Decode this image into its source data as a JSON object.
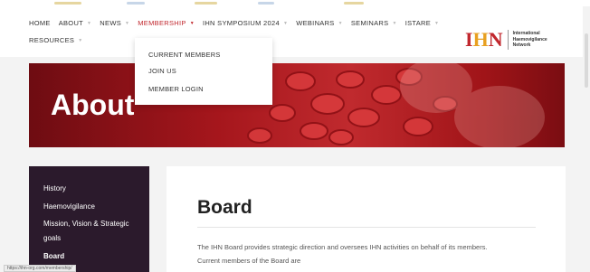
{
  "nav": {
    "row1": [
      {
        "label": "HOME",
        "caret": false,
        "active": false
      },
      {
        "label": "ABOUT",
        "caret": true,
        "active": false
      },
      {
        "label": "NEWS",
        "caret": true,
        "active": false
      },
      {
        "label": "MEMBERSHIP",
        "caret": true,
        "active": true
      },
      {
        "label": "IHN SYMPOSIUM 2024",
        "caret": true,
        "active": false
      },
      {
        "label": "WEBINARS",
        "caret": true,
        "active": false
      },
      {
        "label": "SEMINARS",
        "caret": true,
        "active": false
      },
      {
        "label": "ISTARE",
        "caret": true,
        "active": false
      }
    ],
    "row2": [
      {
        "label": "RESOURCES",
        "caret": true,
        "active": false
      }
    ]
  },
  "logo": {
    "mark_i": "I",
    "mark_h": "H",
    "mark_n": "N",
    "line1": "International",
    "line2": "Haemovigilance",
    "line3": "Network"
  },
  "dropdown": {
    "items": [
      "CURRENT MEMBERS",
      "JOIN US",
      "MEMBER LOGIN"
    ]
  },
  "hero": {
    "title": "About"
  },
  "sidebar": {
    "items": [
      {
        "label": "History"
      },
      {
        "label": "Haemovigilance"
      },
      {
        "label": "Mission, Vision & Strategic"
      },
      {
        "label": "goals"
      },
      {
        "label": "Board"
      }
    ]
  },
  "content": {
    "title": "Board",
    "para_line1": "The IHN Board provides strategic direction and oversees IHN activities on behalf of its members.",
    "para_line2": "Current members of the Board are"
  },
  "statusbar": {
    "url": "https://ihn-org.com/membership/"
  },
  "colors": {
    "accent": "#c1272d",
    "logo_h": "#e8a020",
    "sidebar_bg": "#2b1a2c"
  }
}
